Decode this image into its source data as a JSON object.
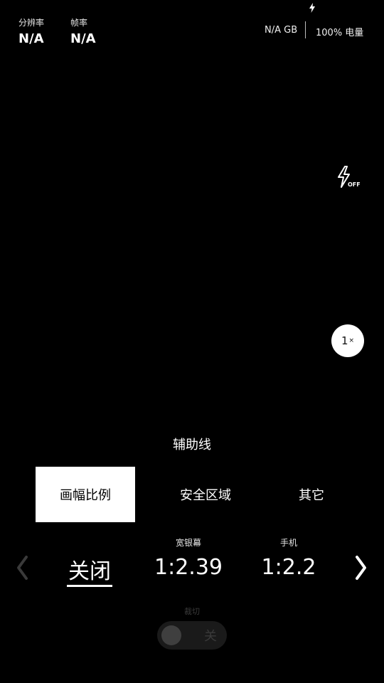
{
  "status_bar": {
    "resolution_label": "分辨率",
    "resolution_value": "N/A",
    "fps_label": "帧率",
    "fps_value": "N/A",
    "storage": "N/A GB",
    "battery": "100% 电量"
  },
  "controls": {
    "flash_icon": "flash-off-icon",
    "zoom_value": "1",
    "zoom_suffix": "×"
  },
  "guides_panel": {
    "title": "辅助线",
    "tabs": [
      {
        "label": "画幅比例",
        "active": true
      },
      {
        "label": "安全区域",
        "active": false
      },
      {
        "label": "其它",
        "active": false
      }
    ],
    "ratios": [
      {
        "top": "",
        "value": "关闭",
        "selected": true
      },
      {
        "top": "宽银幕",
        "value": "1:2.39",
        "selected": false
      },
      {
        "top": "手机",
        "value": "1:2.2",
        "selected": false
      }
    ],
    "crop_label": "裁切",
    "crop_toggle": "关"
  }
}
